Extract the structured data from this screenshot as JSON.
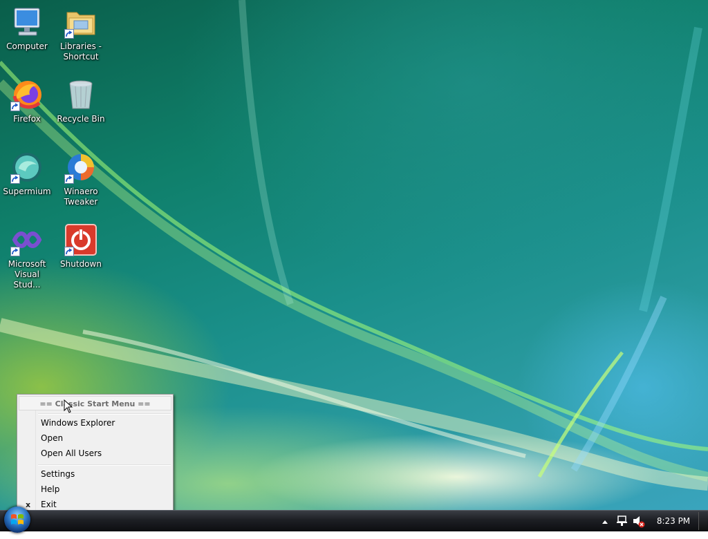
{
  "desktop": {
    "icons": [
      {
        "label": "Computer",
        "icon": "computer-icon",
        "shortcut": false
      },
      {
        "label": "Libraries - Shortcut",
        "icon": "libraries-folder-icon",
        "shortcut": true
      },
      {
        "label": "Firefox",
        "icon": "firefox-icon",
        "shortcut": true
      },
      {
        "label": "Recycle Bin",
        "icon": "recycle-bin-icon",
        "shortcut": false
      },
      {
        "label": "Supermium",
        "icon": "supermium-icon",
        "shortcut": true
      },
      {
        "label": "Winaero Tweaker",
        "icon": "winaero-tweaker-icon",
        "shortcut": true
      },
      {
        "label": "Microsoft Visual Stud...",
        "icon": "visual-studio-icon",
        "shortcut": true
      },
      {
        "label": "Shutdown",
        "icon": "shutdown-icon",
        "shortcut": true
      }
    ]
  },
  "context_menu": {
    "header": "== Classic Start Menu ==",
    "items": [
      {
        "label": "Windows Explorer"
      },
      {
        "label": "Open"
      },
      {
        "label": "Open All Users"
      },
      {
        "label": "Settings"
      },
      {
        "label": "Help"
      },
      {
        "label": "Exit",
        "mark": "x"
      }
    ]
  },
  "taskbar": {
    "clock": "8:23 PM",
    "tray_icons": [
      "show-hidden-icons-arrow",
      "network-icon",
      "volume-muted-icon"
    ]
  },
  "colors": {
    "menu_bg": "#f0f0f0",
    "taskbar": "#1d1f24",
    "desktop_teal": "#1a8f8a"
  }
}
